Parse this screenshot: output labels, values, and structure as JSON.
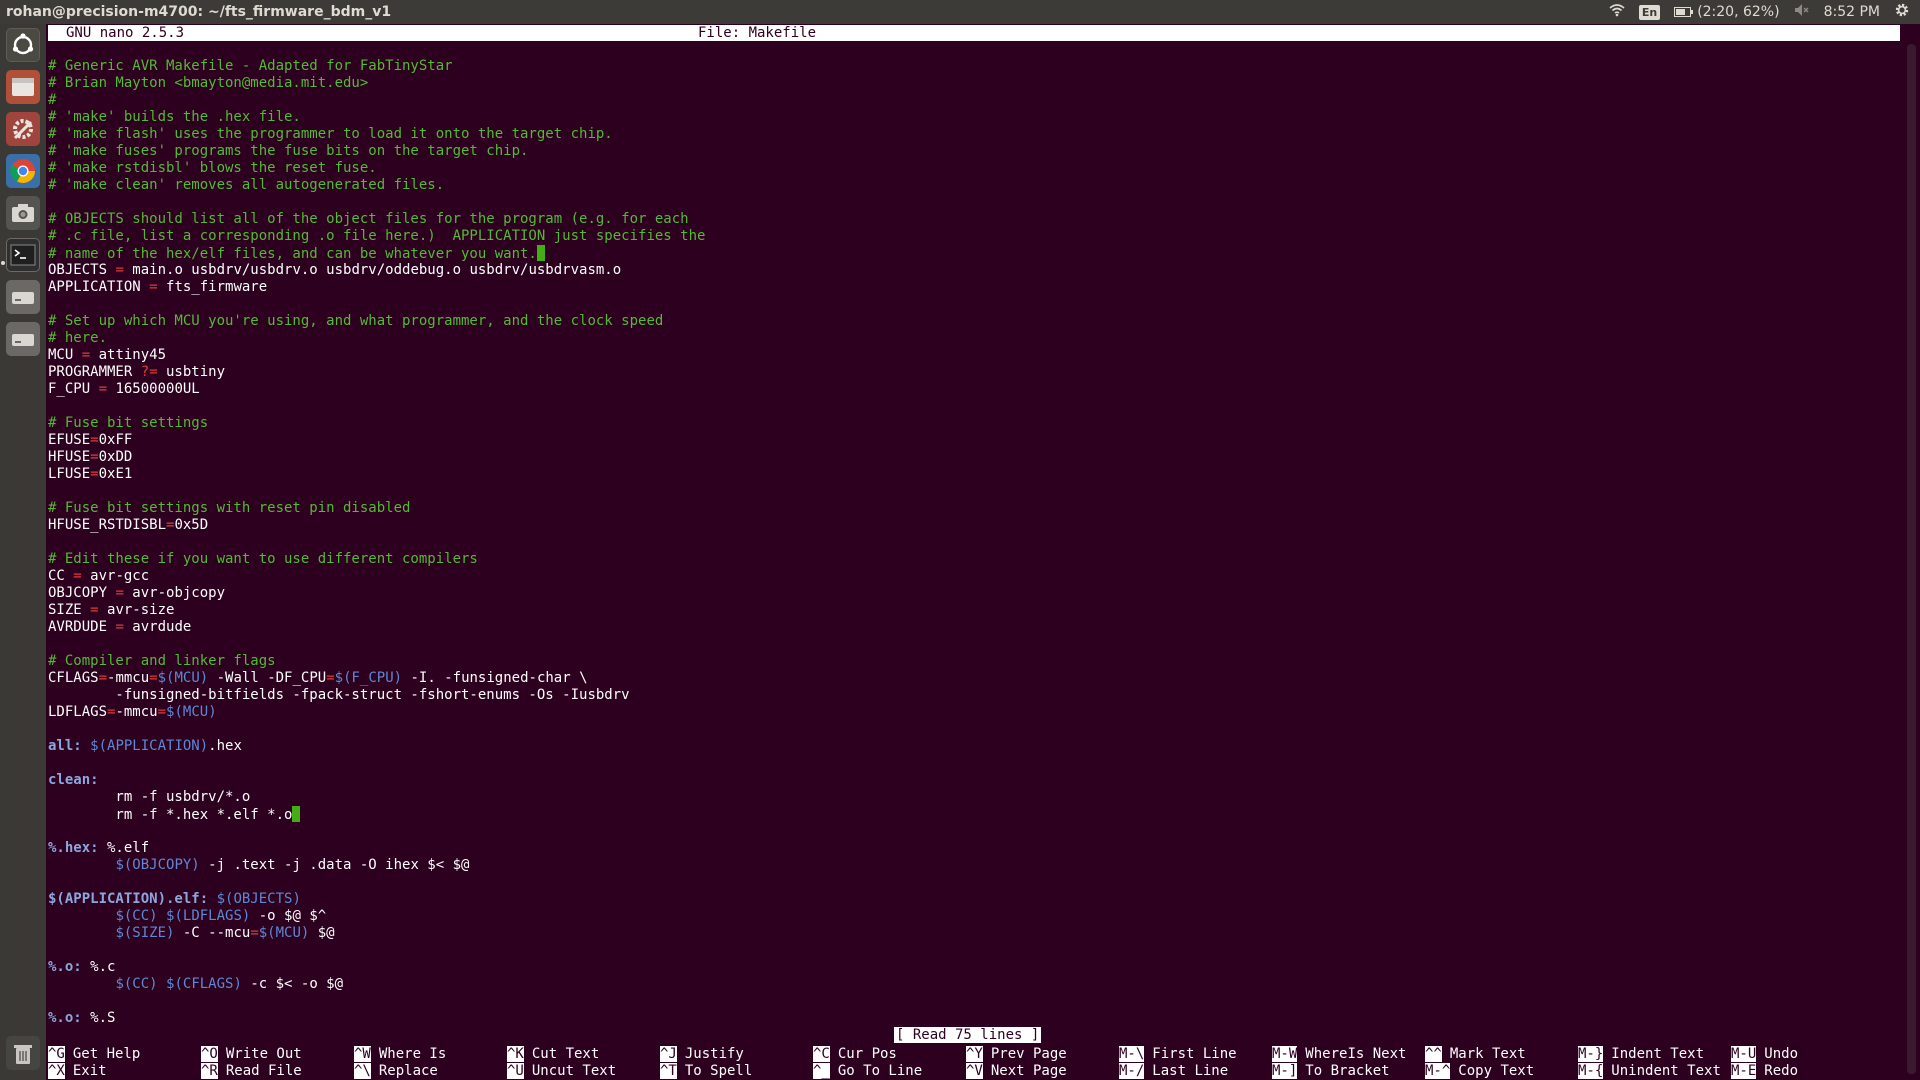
{
  "panel": {
    "window_title": "rohan@precision-m4700: ~/fts_firmware_bdm_v1",
    "keyboard_layout": "En",
    "battery": "(2:20, 62%)",
    "clock": "8:52 PM",
    "icons": [
      "wifi-icon",
      "keyboard-icon",
      "battery-icon",
      "volume-muted-icon",
      "gear-icon"
    ]
  },
  "launcher": {
    "items": [
      {
        "name": "ubuntu-dash-icon"
      },
      {
        "name": "file-manager-icon"
      },
      {
        "name": "system-settings-icon"
      },
      {
        "name": "chrome-icon"
      },
      {
        "name": "screenshot-icon"
      },
      {
        "name": "terminal-icon"
      },
      {
        "name": "drive-icon"
      },
      {
        "name": "drive-icon-2"
      },
      {
        "name": "trash-icon"
      }
    ]
  },
  "colors": {
    "terminal_bg": "#2c001e",
    "comment": "#55b935",
    "operator": "#e13c3c",
    "variable": "#5f88d3",
    "target": "#8da6dd",
    "cursor": "#44ad15"
  },
  "nano": {
    "version": "GNU nano 2.5.3",
    "file": "File: Makefile",
    "status": "[ Read 75 lines ]"
  },
  "editor_lines": [
    [
      [
        "c",
        "# Generic AVR Makefile - Adapted for FabTinyStar"
      ]
    ],
    [
      [
        "c",
        "# Brian Mayton <bmayton@media.mit.edu>"
      ]
    ],
    [
      [
        "c",
        "#"
      ]
    ],
    [
      [
        "c",
        "# 'make' builds the .hex file."
      ]
    ],
    [
      [
        "c",
        "# 'make flash' uses the programmer to load it onto the target chip."
      ]
    ],
    [
      [
        "c",
        "# 'make fuses' programs the fuse bits on the target chip."
      ]
    ],
    [
      [
        "c",
        "# 'make rstdisbl' blows the reset fuse."
      ]
    ],
    [
      [
        "c",
        "# 'make clean' removes all autogenerated files."
      ]
    ],
    [],
    [
      [
        "c",
        "# OBJECTS should list all of the object files for the program (e.g. for each"
      ]
    ],
    [
      [
        "c",
        "# .c file, list a corresponding .o file here.)  APPLICATION just specifies the"
      ]
    ],
    [
      [
        "c",
        "# name of the hex/elf files, and can be whatever you want."
      ],
      [
        "cur",
        ""
      ]
    ],
    [
      [
        "t",
        "OBJECTS "
      ],
      [
        "op",
        "="
      ],
      [
        "t",
        " main.o usbdrv/usbdrv.o usbdrv/oddebug.o usbdrv/usbdrvasm.o"
      ]
    ],
    [
      [
        "t",
        "APPLICATION "
      ],
      [
        "op",
        "="
      ],
      [
        "t",
        " fts_firmware"
      ]
    ],
    [],
    [
      [
        "c",
        "# Set up which MCU you're using, and what programmer, and the clock speed"
      ]
    ],
    [
      [
        "c",
        "# here."
      ]
    ],
    [
      [
        "t",
        "MCU "
      ],
      [
        "op",
        "="
      ],
      [
        "t",
        " attiny45"
      ]
    ],
    [
      [
        "t",
        "PROGRAMMER "
      ],
      [
        "op",
        "?="
      ],
      [
        "t",
        " usbtiny"
      ]
    ],
    [
      [
        "t",
        "F_CPU "
      ],
      [
        "op",
        "="
      ],
      [
        "t",
        " 16500000UL"
      ]
    ],
    [],
    [
      [
        "c",
        "# Fuse bit settings"
      ]
    ],
    [
      [
        "t",
        "EFUSE"
      ],
      [
        "op",
        "="
      ],
      [
        "t",
        "0xFF"
      ]
    ],
    [
      [
        "t",
        "HFUSE"
      ],
      [
        "op",
        "="
      ],
      [
        "t",
        "0xDD"
      ]
    ],
    [
      [
        "t",
        "LFUSE"
      ],
      [
        "op",
        "="
      ],
      [
        "t",
        "0xE1"
      ]
    ],
    [],
    [
      [
        "c",
        "# Fuse bit settings with reset pin disabled"
      ]
    ],
    [
      [
        "t",
        "HFUSE_RSTDISBL"
      ],
      [
        "op",
        "="
      ],
      [
        "t",
        "0x5D"
      ]
    ],
    [],
    [
      [
        "c",
        "# Edit these if you want to use different compilers"
      ]
    ],
    [
      [
        "t",
        "CC "
      ],
      [
        "op",
        "="
      ],
      [
        "t",
        " avr-gcc"
      ]
    ],
    [
      [
        "t",
        "OBJCOPY "
      ],
      [
        "op",
        "="
      ],
      [
        "t",
        " avr-objcopy"
      ]
    ],
    [
      [
        "t",
        "SIZE "
      ],
      [
        "op",
        "="
      ],
      [
        "t",
        " avr-size"
      ]
    ],
    [
      [
        "t",
        "AVRDUDE "
      ],
      [
        "op",
        "="
      ],
      [
        "t",
        " avrdude"
      ]
    ],
    [],
    [
      [
        "c",
        "# Compiler and linker flags"
      ]
    ],
    [
      [
        "t",
        "CFLAGS"
      ],
      [
        "op",
        "="
      ],
      [
        "t",
        "-mmcu"
      ],
      [
        "op",
        "="
      ],
      [
        "var",
        "$(MCU)"
      ],
      [
        "t",
        " -Wall -DF_CPU"
      ],
      [
        "op",
        "="
      ],
      [
        "var",
        "$(F_CPU)"
      ],
      [
        "t",
        " -I. -funsigned-char \\"
      ]
    ],
    [
      [
        "t",
        "        -funsigned-bitfields -fpack-struct -fshort-enums -Os -Iusbdrv"
      ]
    ],
    [
      [
        "t",
        "LDFLAGS"
      ],
      [
        "op",
        "="
      ],
      [
        "t",
        "-mmcu"
      ],
      [
        "op",
        "="
      ],
      [
        "var",
        "$(MCU)"
      ]
    ],
    [],
    [
      [
        "tgt",
        "all:"
      ],
      [
        "t",
        " "
      ],
      [
        "var",
        "$(APPLICATION)"
      ],
      [
        "t",
        ".hex"
      ]
    ],
    [],
    [
      [
        "tgt",
        "clean:"
      ]
    ],
    [
      [
        "t",
        "        rm -f usbdrv/*.o"
      ]
    ],
    [
      [
        "t",
        "        rm -f *.hex *.elf *.o"
      ],
      [
        "cur",
        ""
      ]
    ],
    [],
    [
      [
        "tgt",
        "%.hex:"
      ],
      [
        "t",
        " %.elf"
      ]
    ],
    [
      [
        "t",
        "        "
      ],
      [
        "var",
        "$(OBJCOPY)"
      ],
      [
        "t",
        " -j .text -j .data -O ihex $< $@"
      ]
    ],
    [],
    [
      [
        "tgt",
        "$(APPLICATION).elf:"
      ],
      [
        "t",
        " "
      ],
      [
        "var",
        "$(OBJECTS)"
      ]
    ],
    [
      [
        "t",
        "        "
      ],
      [
        "var",
        "$(CC)"
      ],
      [
        "t",
        " "
      ],
      [
        "var",
        "$(LDFLAGS)"
      ],
      [
        "t",
        " -o $@ $^"
      ]
    ],
    [
      [
        "t",
        "        "
      ],
      [
        "var",
        "$(SIZE)"
      ],
      [
        "t",
        " -C --mcu"
      ],
      [
        "op",
        "="
      ],
      [
        "var",
        "$(MCU)"
      ],
      [
        "t",
        " $@"
      ]
    ],
    [],
    [
      [
        "tgt",
        "%.o:"
      ],
      [
        "t",
        " %.c"
      ]
    ],
    [
      [
        "t",
        "        "
      ],
      [
        "var",
        "$(CC)"
      ],
      [
        "t",
        " "
      ],
      [
        "var",
        "$(CFLAGS)"
      ],
      [
        "t",
        " -c $< -o $@"
      ]
    ],
    [],
    [
      [
        "tgt",
        "%.o:"
      ],
      [
        "t",
        " %.S"
      ]
    ]
  ],
  "shortcuts": [
    {
      "key": "^G",
      "label": "Get Help"
    },
    {
      "key": "^X",
      "label": "Exit"
    },
    {
      "key": "^O",
      "label": "Write Out"
    },
    {
      "key": "^R",
      "label": "Read File"
    },
    {
      "key": "^W",
      "label": "Where Is"
    },
    {
      "key": "^\\",
      "label": "Replace"
    },
    {
      "key": "^K",
      "label": "Cut Text"
    },
    {
      "key": "^U",
      "label": "Uncut Text"
    },
    {
      "key": "^J",
      "label": "Justify"
    },
    {
      "key": "^T",
      "label": "To Spell"
    },
    {
      "key": "^C",
      "label": "Cur Pos"
    },
    {
      "key": "^_",
      "label": "Go To Line"
    },
    {
      "key": "^Y",
      "label": "Prev Page"
    },
    {
      "key": "^V",
      "label": "Next Page"
    },
    {
      "key": "M-\\",
      "label": "First Line"
    },
    {
      "key": "M-/",
      "label": "Last Line"
    },
    {
      "key": "M-W",
      "label": "WhereIs Next"
    },
    {
      "key": "M-]",
      "label": "To Bracket"
    },
    {
      "key": "^^",
      "label": "Mark Text"
    },
    {
      "key": "M-^",
      "label": "Copy Text"
    },
    {
      "key": "M-}",
      "label": "Indent Text"
    },
    {
      "key": "M-{",
      "label": "Unindent Text"
    },
    {
      "key": "M-U",
      "label": "Undo"
    },
    {
      "key": "M-E",
      "label": "Redo"
    }
  ]
}
